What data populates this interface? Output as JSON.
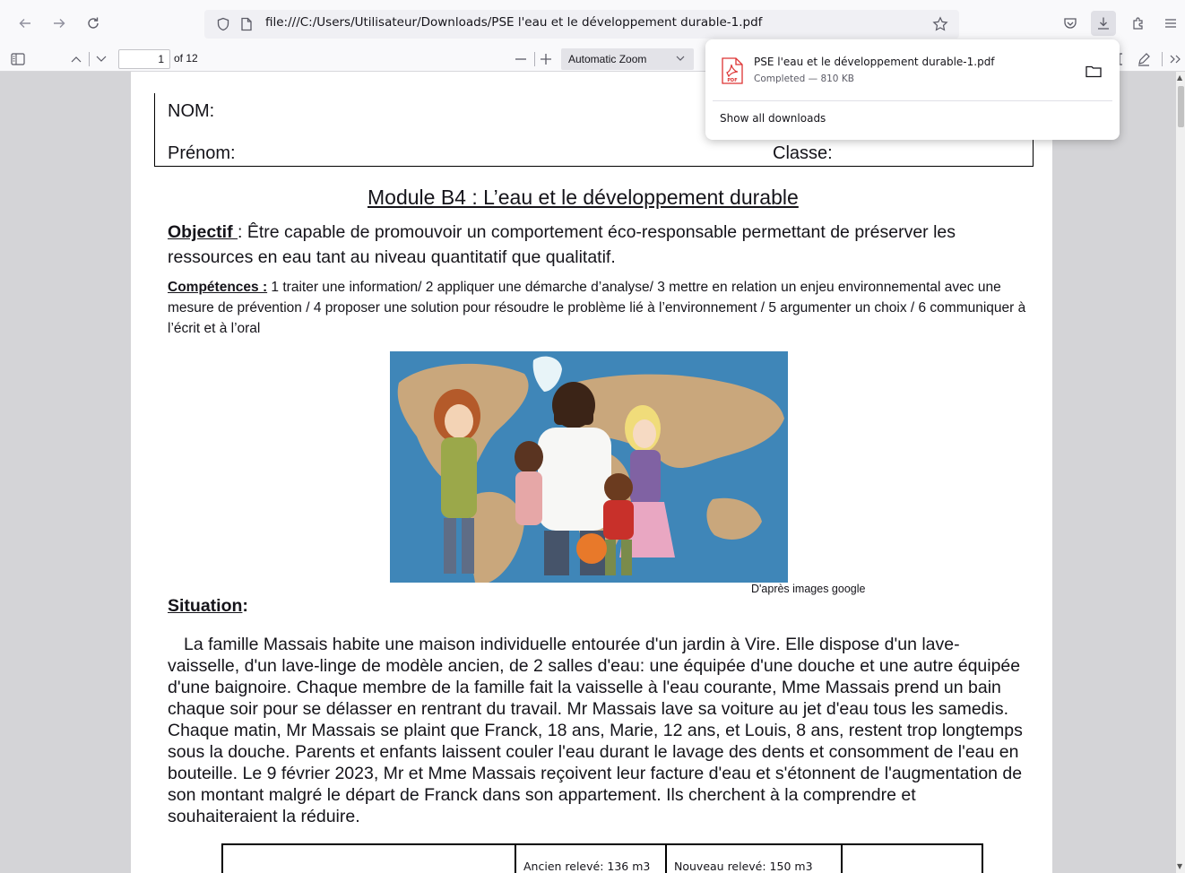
{
  "browser": {
    "url": "file:///C:/Users/Utilisateur/Downloads/PSE l'eau et le développement durable-1.pdf"
  },
  "pdf_toolbar": {
    "page_number": "1",
    "page_count": "of 12",
    "zoom": "Automatic Zoom"
  },
  "downloads": {
    "file_name": "PSE l'eau et le développement durable-1.pdf",
    "status": "Completed — 810 KB",
    "file_badge": "PDF",
    "show_all": "Show all downloads"
  },
  "document": {
    "nom": "NOM:",
    "prenom": "Prénom:",
    "classe": "Classe:",
    "title": "Module B4 : L’eau et le développement durable",
    "objectif_label": "Objectif ",
    "objectif_text": ": Être capable de promouvoir un comportement éco-responsable permettant de préserver les ressources en eau tant au niveau quantitatif que qualitatif.",
    "competences_label": "Compétences :",
    "competences_text": " 1 traiter une information/ 2 appliquer une démarche d’analyse/ 3 mettre en relation un enjeu environnemental avec une mesure de prévention / 4 proposer une solution pour résoudre le problème lié à l’environnement / 5 argumenter un choix / 6 communiquer à l’écrit et à l’oral",
    "image_credit": "D'après images google",
    "situation_label": "Situation",
    "situation_colon": ":",
    "situation_text": "La famille Massais habite une maison individuelle entourée d'un jardin à Vire. Elle dispose d'un lave-vaisselle, d'un lave-linge  de modèle ancien, de 2 salles d'eau: une équipée d'une douche et une autre équipée d'une baignoire. Chaque membre de la famille fait la vaisselle à l'eau courante, Mme Massais prend un bain chaque soir pour se délasser en rentrant du travail. Mr Massais lave sa voiture au jet d'eau tous les samedis. Chaque matin, Mr Massais se plaint que Franck, 18 ans, Marie, 12 ans, et Louis, 8 ans, restent trop longtemps sous la douche. Parents et enfants laissent couler l'eau durant le lavage des dents et consomment de l'eau en bouteille. Le 9 février 2023, Mr et Mme Massais reçoivent leur facture d'eau et s'étonnent de l'augmentation de son montant malgré le départ de Franck dans son appartement. Ils cherchent à la comprendre et souhaiteraient la réduire.",
    "table_old_reading": "Ancien relevé: 136 m3",
    "table_new_reading": "Nouveau relevé: 150 m3"
  }
}
